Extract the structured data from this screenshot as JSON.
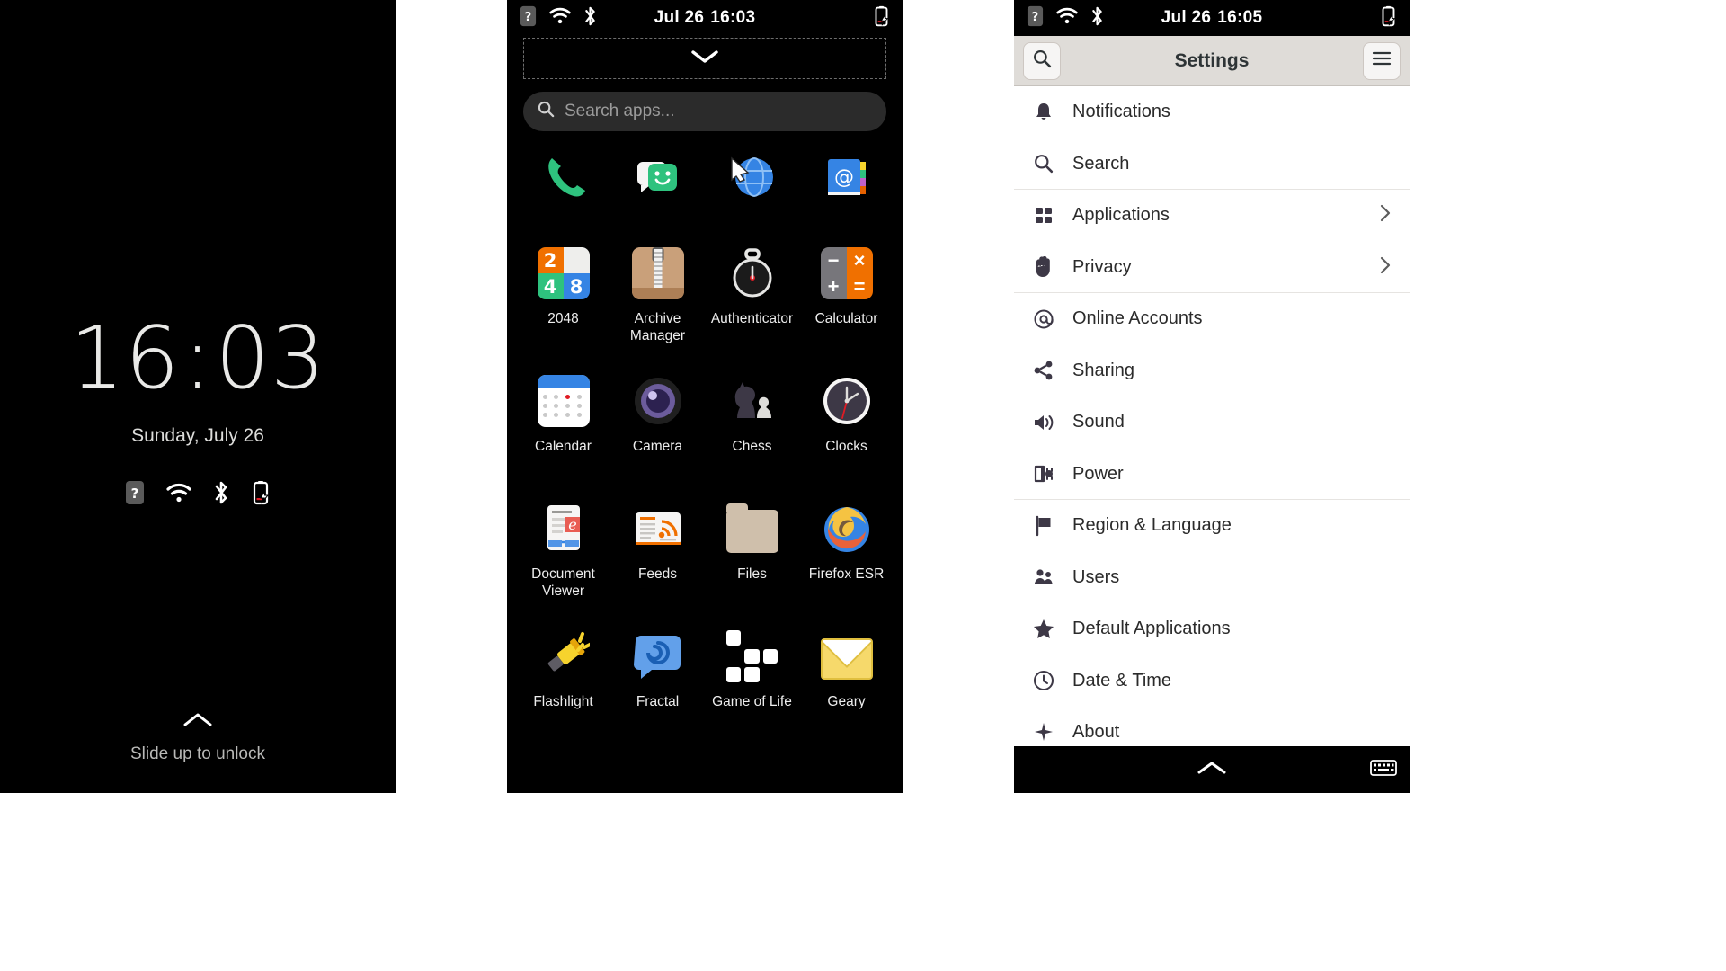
{
  "lockscreen": {
    "time": "16:03",
    "hours": "16",
    "minutes": "03",
    "date": "Sunday, July 26",
    "unlock_hint": "Slide up to unlock",
    "status_icons": [
      "cellular-unknown-icon",
      "wifi-icon",
      "bluetooth-icon",
      "battery-charging-icon"
    ]
  },
  "appdrawer": {
    "statusbar": {
      "date": "Jul 26",
      "time": "16:03",
      "icons": [
        "cellular-unknown-icon",
        "wifi-icon",
        "bluetooth-icon",
        "battery-charging-icon"
      ]
    },
    "search": {
      "placeholder": "Search apps...",
      "value": ""
    },
    "favorites": [
      {
        "name": "Phone",
        "icon": "phone-icon"
      },
      {
        "name": "Chats",
        "icon": "chat-icon"
      },
      {
        "name": "Web",
        "icon": "globe-icon"
      },
      {
        "name": "Contacts",
        "icon": "address-book-icon"
      }
    ],
    "apps": [
      {
        "label": "2048",
        "icon": "2048-icon"
      },
      {
        "label": "Archive Manager",
        "icon": "archive-icon"
      },
      {
        "label": "Authenticator",
        "icon": "authenticator-icon"
      },
      {
        "label": "Calculator",
        "icon": "calculator-icon"
      },
      {
        "label": "Calendar",
        "icon": "calendar-icon"
      },
      {
        "label": "Camera",
        "icon": "camera-icon"
      },
      {
        "label": "Chess",
        "icon": "chess-icon"
      },
      {
        "label": "Clocks",
        "icon": "clocks-icon"
      },
      {
        "label": "Document Viewer",
        "icon": "document-viewer-icon"
      },
      {
        "label": "Feeds",
        "icon": "feeds-icon"
      },
      {
        "label": "Files",
        "icon": "files-icon"
      },
      {
        "label": "Firefox ESR",
        "icon": "firefox-icon"
      },
      {
        "label": "Flashlight",
        "icon": "flashlight-icon"
      },
      {
        "label": "Fractal",
        "icon": "fractal-icon"
      },
      {
        "label": "Game of Life",
        "icon": "game-of-life-icon"
      },
      {
        "label": "Geary",
        "icon": "geary-icon"
      }
    ]
  },
  "settings": {
    "statusbar": {
      "date": "Jul 26",
      "time": "16:05",
      "icons": [
        "cellular-unknown-icon",
        "wifi-icon",
        "bluetooth-icon",
        "battery-charging-icon"
      ]
    },
    "header": {
      "title": "Settings",
      "search_button": "search-icon",
      "menu_button": "hamburger-icon"
    },
    "rows": [
      {
        "label": "Notifications",
        "icon": "bell-icon",
        "chevron": false,
        "divider": false
      },
      {
        "label": "Search",
        "icon": "search-icon",
        "chevron": false,
        "divider": true
      },
      {
        "label": "Applications",
        "icon": "grid-icon",
        "chevron": true,
        "divider": false
      },
      {
        "label": "Privacy",
        "icon": "hand-icon",
        "chevron": true,
        "divider": true
      },
      {
        "label": "Online Accounts",
        "icon": "at-icon",
        "chevron": false,
        "divider": false
      },
      {
        "label": "Sharing",
        "icon": "share-icon",
        "chevron": false,
        "divider": true
      },
      {
        "label": "Sound",
        "icon": "speaker-icon",
        "chevron": false,
        "divider": false
      },
      {
        "label": "Power",
        "icon": "power-plug-icon",
        "chevron": false,
        "divider": true
      },
      {
        "label": "Region & Language",
        "icon": "flag-icon",
        "chevron": false,
        "divider": false
      },
      {
        "label": "Users",
        "icon": "users-icon",
        "chevron": false,
        "divider": false
      },
      {
        "label": "Default Applications",
        "icon": "star-icon",
        "chevron": false,
        "divider": false
      },
      {
        "label": "Date & Time",
        "icon": "clock-icon",
        "chevron": false,
        "divider": false
      },
      {
        "label": "About",
        "icon": "sparkle-icon",
        "chevron": false,
        "divider": false
      }
    ],
    "bottombar": {
      "home_icon": "chevron-up-icon",
      "keyboard_icon": "keyboard-icon"
    }
  },
  "colors": {
    "accent_blue": "#3584e4",
    "orange": "#f07000",
    "green": "#2ec27e",
    "header_bg": "#dfdcd8",
    "panel_bg": "#000000",
    "text_light": "#ededed"
  }
}
